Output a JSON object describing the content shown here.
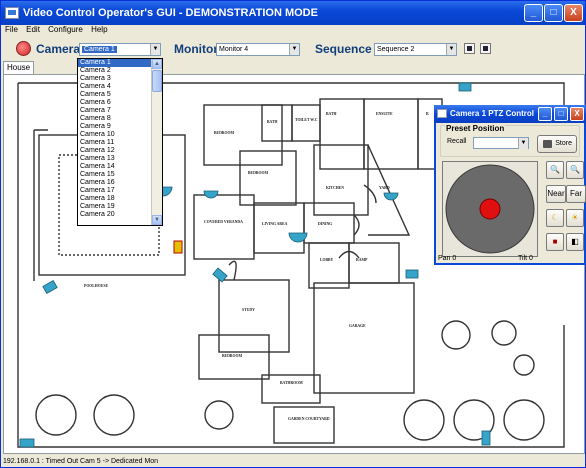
{
  "window": {
    "title": "Video Control Operator's GUI - DEMONSTRATION MODE",
    "minimize": "_",
    "maximize": "□",
    "close": "X"
  },
  "menu": [
    "File",
    "Edit",
    "Configure",
    "Help"
  ],
  "toolbar": {
    "camera_label": "Camera",
    "camera_value": "Camera 1",
    "monitor_label": "Monitor",
    "monitor_value": "Monitor 4",
    "sequence_label": "Sequence",
    "sequence_value": "Sequence 2"
  },
  "tabs": [
    "House"
  ],
  "camera_dropdown": {
    "selected": "Camera 1",
    "options": [
      "Camera 1",
      "Camera 2",
      "Camera 3",
      "Camera 4",
      "Camera 5",
      "Camera 6",
      "Camera 7",
      "Camera 8",
      "Camera 9",
      "Camera 10",
      "Camera 11",
      "Camera 12",
      "Camera 13",
      "Camera 14",
      "Camera 15",
      "Camera 16",
      "Camera 17",
      "Camera 18",
      "Camera 19",
      "Camera 20"
    ]
  },
  "floorplan": {
    "rooms": [
      "BEDROOM",
      "BATH",
      "TOILET W.C",
      "BATH",
      "ENSUITE",
      "R",
      "BEDROOM",
      "KITCHEN",
      "YARD",
      "COVERED VERANDA",
      "LIVING AREA",
      "DINING",
      "LOBBY",
      "RAMP",
      "POOLHOUSE",
      "STUDY",
      "GARAGE",
      "BEDROOM",
      "BATHROOM",
      "GARDEN COURTYARD"
    ]
  },
  "ptz": {
    "title": "Camera 1 PTZ Control",
    "preset_label": "Preset Position",
    "recall_label": "Recall",
    "store_label": "Store",
    "near_label": "Near",
    "far_label": "Far",
    "pan_label": "Pan 0",
    "tilt_label": "Tilt 0"
  },
  "status": {
    "text": "192.168.0.1    : Timed Out Cam 5 -> Dedicated Mon"
  },
  "colors": {
    "title_blue": "#0A48D8",
    "accent": "#316AC5",
    "joystick_dot": "#E01010",
    "camera_icon": "#36A4C8"
  }
}
